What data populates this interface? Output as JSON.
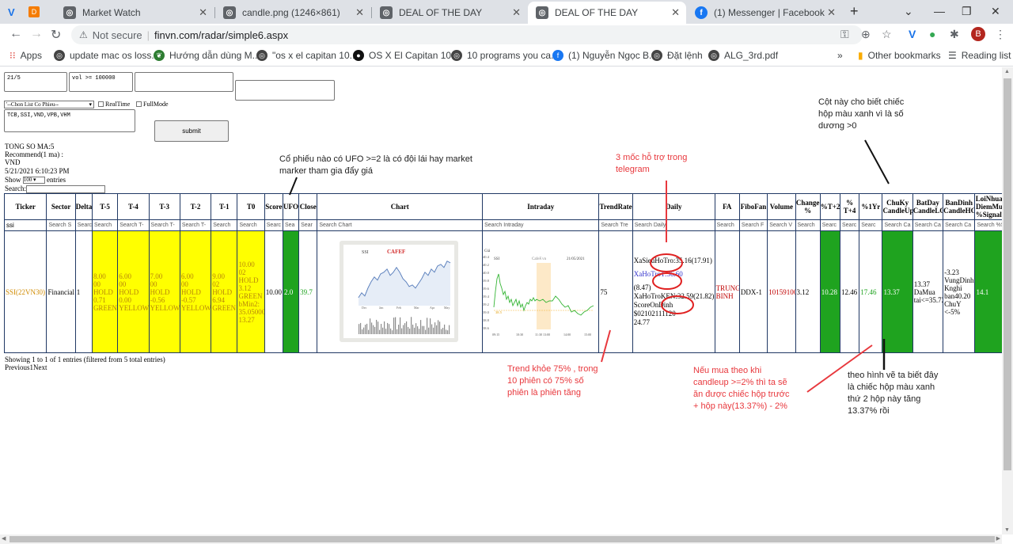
{
  "tabs": [
    {
      "title": "Market Watch"
    },
    {
      "title": "candle.png (1246×861)"
    },
    {
      "title": "DEAL OF THE DAY"
    },
    {
      "title": "DEAL OF THE DAY"
    },
    {
      "title": "(1) Messenger | Facebook"
    }
  ],
  "address": {
    "security": "Not secure",
    "url": "finvn.com/radar/simple6.aspx"
  },
  "bookmarks": {
    "apps": "Apps",
    "items": [
      "update mac os loss...",
      "Hướng dẫn dùng M...",
      "\"os x el capitan 10....",
      "OS X El Capitan 10....",
      "10 programs you ca...",
      "(1) Nguyễn Ngọc B...",
      "Đặt lệnh",
      "ALG_3rd.pdf"
    ],
    "more": "»",
    "other": "Other bookmarks",
    "reading": "Reading list"
  },
  "avatar_letter": "B",
  "form": {
    "ta1": "21/5",
    "ta2": "vol >= 100000",
    "ta3": "",
    "input4": "",
    "select": "'--Chon List Co Phieu--",
    "realtime": "RealTime",
    "fullmode": "FullMode",
    "list": "TCB,SSI,VND,VPB,VHM",
    "submit": "submit"
  },
  "info": {
    "total": "TONG SO MA:5",
    "recommend": "Recommend(1 ma) :",
    "code": "VND",
    "time": "5/21/2021 6:10:23 PM",
    "show": "Show",
    "show_value": "100",
    "entries": "entries",
    "search": "Search:"
  },
  "table": {
    "headers": [
      "Ticker",
      "Sector",
      "Delta",
      "T-5",
      "T-4",
      "T-3",
      "T-2",
      "T-1",
      "T0",
      "Score",
      "UFO",
      "Close",
      "Chart",
      "Intraday",
      "TrendRate",
      "Daily",
      "FA",
      "FiboFan",
      "Volume",
      "Change %",
      "%T+2",
      "% T+4",
      "%1Yr",
      "ChuKy CandleUp",
      "BatDay CandleLC",
      "BanDinh CandleHC",
      "LoiNhuan DiemMua %SignalT"
    ],
    "filters": [
      "ssi",
      "Search S",
      "Search",
      "Search",
      "Search T-",
      "Search T-",
      "Search T-",
      "Search",
      "Search",
      "Searc",
      "Sea",
      "Sear",
      "Search Chart",
      "Search Intraday",
      "Search Tre",
      "Search Daily",
      "Search",
      "Search F",
      "Search V",
      "Search",
      "Searc",
      "Searc",
      "Searc",
      "Search Ca",
      "Search Ca",
      "Search Ca",
      "Search %S"
    ],
    "row": {
      "ticker": "SSI(22VN30)",
      "sector": "Financial",
      "delta": "1",
      "t5": "8.00\n00\nHOLD\n0.71\nGREEN",
      "t4": "6.00\n00\nHOLD\n0.00\nYELLOW",
      "t3": "7.00\n00\nHOLD\n-0.56\nYELLOW",
      "t2": "6.00\n00\nHOLD\n-0.57\nYELLOW",
      "t1": "9.00\n02\nHOLD\n6.94\nGREEN",
      "t0": "10.00\n02\nHOLD\n3.12\nGREEN\nbMin2:\n35.05000\n13.27",
      "score": "10.00",
      "ufo": "2.0",
      "close": "39.7",
      "chart_sym": "SSI",
      "chart_brand": "CAFEF",
      "intraday_price": "Giá",
      "intraday_sym": "SSI",
      "intraday_brand": "CafeF.vn",
      "intraday_date": "21/05/2021",
      "intraday_yticks": [
        "40.4",
        "40.2",
        "40.0",
        "39.8",
        "39.6",
        "39.4",
        "39.2",
        "39.0",
        "38.8",
        "38.6"
      ],
      "intraday_ref": "38.5",
      "intraday_xticks": [
        "09:15",
        "10:30",
        "11:30 13:00",
        "14:00",
        "15:00"
      ],
      "chart_months": [
        "Dec",
        "Jan",
        "Feb",
        "Mar",
        "Apr",
        "May"
      ],
      "trendrate": "75",
      "daily": {
        "sieuho": "XaSieuHoTro:35.16(17.91)",
        "hotro": "XaHoTroT:36.60",
        "pct": "(8.47)",
        "hotroken": "XaHoTroKEN:32.59(21.82)",
        "scoreondinh": "ScoreOnDinh",
        "code": "$02102111120",
        "val": "24.77"
      },
      "fa": "TRUNG\nBINH",
      "fibofan": "DDX-1",
      "volume": "10159100",
      "change": "3.12",
      "t2pct": "10.28",
      "t4pct": "12.46",
      "yr": "17.46",
      "chuky": "13.37",
      "batday": "13.37\nDaMua\ntai<=35.72",
      "bandinh": "-3.23\nVungDinh\nKnghi\nban40.20\nChuY\n<-5%",
      "loinhuan": "14.1"
    }
  },
  "footer": {
    "showing": "Showing 1 to 1 of 1 entries (filtered from 5 total entries)",
    "paging": "Previous1Next"
  },
  "annotations": {
    "ufo": "Cổ phiếu nào có UFO >=2 là có đội lái hay market\nmarker tham gia đẩy giá",
    "mocs": "3 mốc hỗ trợ trong\ntelegram",
    "cot": "Cột này cho biết chiếc\nhộp màu xanh vì là số\ndương >0",
    "trend": "Trend khỏe 75% , trong\n10 phiên có 75% số\nphiên là phiên tăng",
    "candle": "Nếu mua theo khi\ncandleup >=2% thì ta sẽ\năn được chiếc hộp trước\n+ hộp này(13.37%) - 2%",
    "hop": "theo hình vẽ ta biết đây\nlà chiếc hộp màu xanh\nthứ 2 hộp này tăng\n13.37% rồi"
  }
}
